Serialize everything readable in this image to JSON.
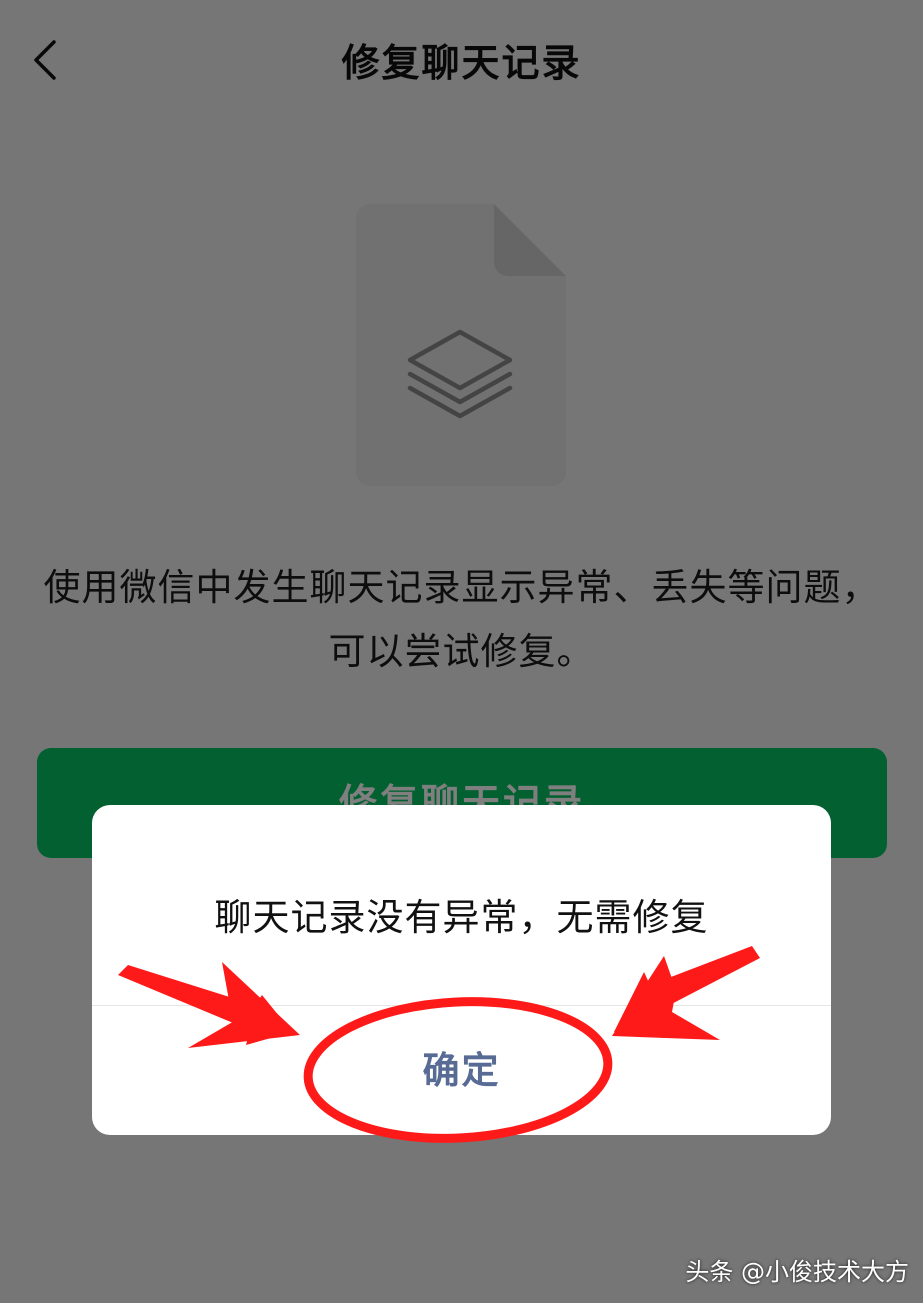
{
  "header": {
    "title": "修复聊天记录",
    "back_icon": "chevron-left-icon"
  },
  "illustration": {
    "icon": "layers-icon",
    "document_icon": "document-icon"
  },
  "main": {
    "description": "使用微信中发生聊天记录显示异常、丢失等问题，可以尝试修复。",
    "repair_button_label": "修复聊天记录"
  },
  "dialog": {
    "message": "聊天记录没有异常，无需修复",
    "confirm_label": "确定"
  },
  "watermark": {
    "text": "头条 @小俊技术大方"
  },
  "colors": {
    "primary_green": "#07c160",
    "link_blue": "#576b95",
    "annotation_red": "#ff1a1a",
    "background": "#ededed"
  }
}
